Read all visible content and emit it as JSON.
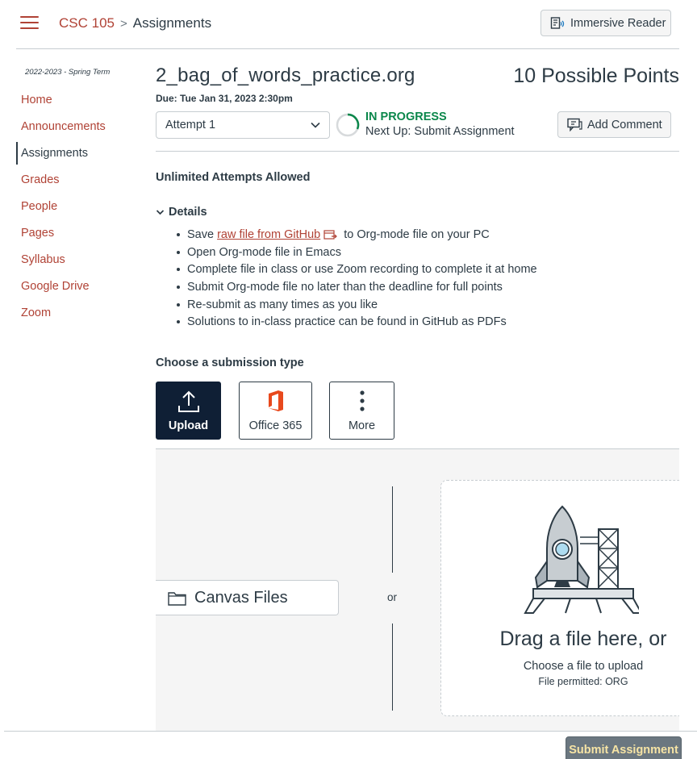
{
  "header": {
    "breadcrumb": {
      "course": "CSC 105",
      "separator": ">",
      "current": "Assignments"
    },
    "immersive_reader_label": "Immersive Reader"
  },
  "sidebar": {
    "term": "2022-2023 - Spring Term",
    "items": [
      {
        "label": "Home",
        "active": false
      },
      {
        "label": "Announcements",
        "active": false
      },
      {
        "label": "Assignments",
        "active": true
      },
      {
        "label": "Grades",
        "active": false
      },
      {
        "label": "People",
        "active": false
      },
      {
        "label": "Pages",
        "active": false
      },
      {
        "label": "Syllabus",
        "active": false
      },
      {
        "label": "Google Drive",
        "active": false
      },
      {
        "label": "Zoom",
        "active": false
      }
    ]
  },
  "assignment": {
    "title": "2_bag_of_words_practice.org",
    "points": "10 Possible Points",
    "due": "Due: Tue Jan 31, 2023 2:30pm",
    "attempt_value": "Attempt 1",
    "status": "IN PROGRESS",
    "next_up": "Next Up: Submit Assignment",
    "add_comment_label": "Add Comment",
    "attempts_note": "Unlimited Attempts Allowed",
    "details_label": "Details",
    "details": {
      "save_prefix": "Save ",
      "save_link": "raw file from GitHub",
      "save_suffix": "to Org-mode file on your PC",
      "items": [
        "Open Org-mode file in Emacs",
        "Complete file in class or use Zoom recording to complete it at home",
        "Submit Org-mode file no later than the deadline for full points",
        "Re-submit as many times as you like",
        "Solutions to in-class practice can be found in GitHub as PDFs"
      ]
    }
  },
  "submission": {
    "heading": "Choose a submission type",
    "types": [
      {
        "label": "Upload",
        "icon": "upload-icon",
        "selected": true
      },
      {
        "label": "Office 365",
        "icon": "office365-icon",
        "selected": false
      },
      {
        "label": "More",
        "icon": "more-vertical-icon",
        "selected": false
      }
    ],
    "canvas_files_label": "Canvas Files",
    "or_label": "or",
    "drag_text": "Drag a file here, or",
    "choose_file_text": "Choose a file to upload",
    "file_permitted": "File permitted: ORG"
  },
  "footer": {
    "submit_label": "Submit Assignment"
  },
  "colors": {
    "brand_link": "#b04235",
    "text": "#2d3b45",
    "status_green": "#0b874b",
    "selected_button": "#0f1f35",
    "submit_bg": "#6b7780",
    "submit_text": "#f6e4a5"
  }
}
